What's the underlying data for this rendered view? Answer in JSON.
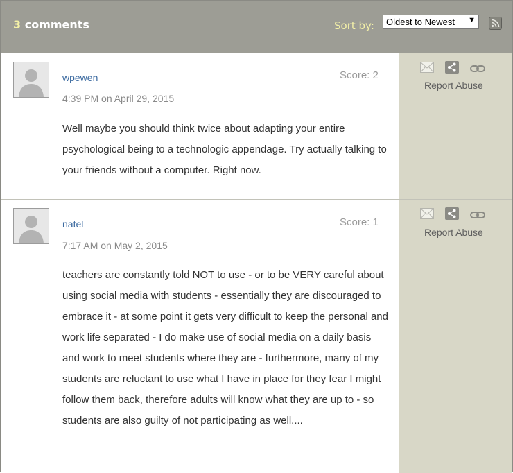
{
  "header": {
    "count": "3",
    "count_label": "comments",
    "sort_label": "Sort by:",
    "sort_selected": "Oldest to Newest"
  },
  "comments": [
    {
      "username": "wpewen",
      "timestamp": "4:39 PM on April 29, 2015",
      "score": "Score: 2",
      "body": "Well maybe you should think twice about adapting your entire psychological being to a technologic appendage. Try actually talking to your friends without a computer. Right now.",
      "report": "Report Abuse"
    },
    {
      "username": "natel",
      "timestamp": "7:17 AM on May 2, 2015",
      "score": "Score: 1",
      "body": "teachers are constantly told NOT to use - or to be VERY careful about using social media with students - essentially they are discouraged to embrace it - at some point it gets very difficult to keep the personal and work life separated - I do make use of social media on a daily basis and work to meet students where they are - furthermore, many of my students are reluctant to use what I have in place for they fear I might follow them back, therefore adults will know what they are up to - so students are also guilty of not participating as well....",
      "report": "Report Abuse"
    }
  ],
  "icons": {
    "rss": "rss-icon",
    "email": "email-icon",
    "share": "share-icon",
    "link": "link-icon",
    "avatar": "default-avatar"
  },
  "colors": {
    "header_bg": "#9d9d95",
    "sidebar_bg": "#d8d7c7",
    "username": "#3b6aa0",
    "count_accent": "#f3f0a6"
  }
}
